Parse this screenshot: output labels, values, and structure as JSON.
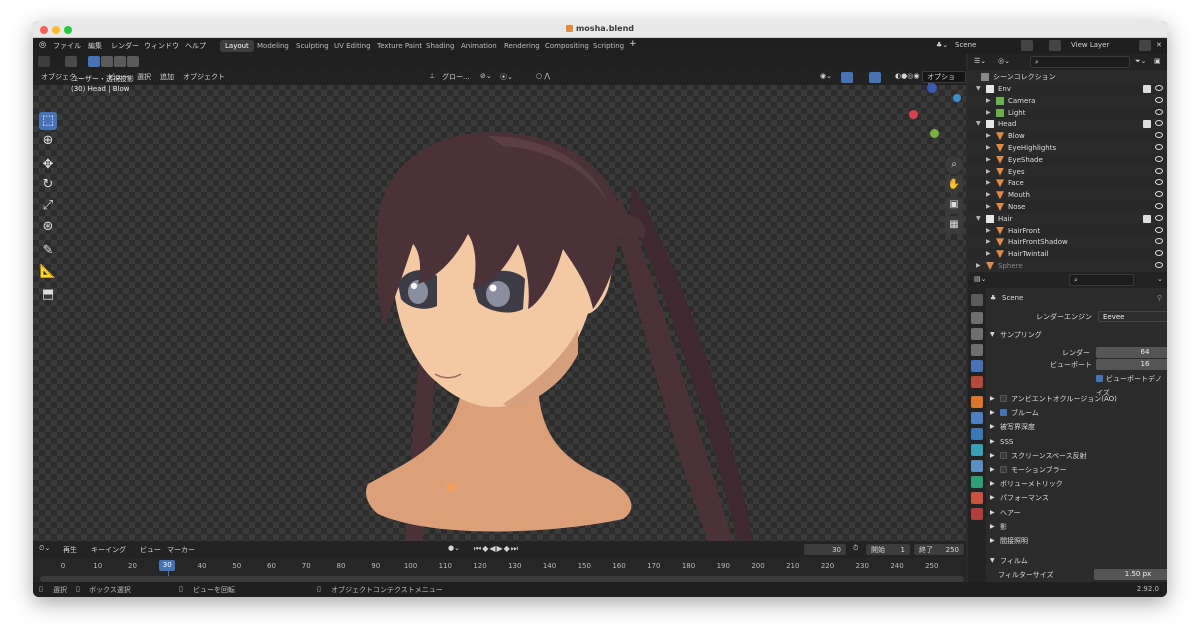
{
  "window": {
    "title": "mosha.blend"
  },
  "topbar": {
    "menus": [
      "ファイル",
      "編集",
      "レンダー",
      "ウィンドウ",
      "ヘルプ"
    ],
    "workspaces": [
      "Layout",
      "Modeling",
      "Sculpting",
      "UV Editing",
      "Texture Paint",
      "Shading",
      "Animation",
      "Rendering",
      "Compositing",
      "Scripting"
    ],
    "active_workspace": "Layout",
    "scene": "Scene",
    "view_layer": "View Layer"
  },
  "viewport": {
    "mode": "オブジェク...",
    "menus": [
      "ビュー",
      "選択",
      "追加",
      "オブジェクト"
    ],
    "transform": "グロー...",
    "options": "オプション",
    "info_line1": "ユーザー・透視投影",
    "info_line2": "(30) Head | Blow"
  },
  "timeline": {
    "menus": [
      "再生",
      "キーイング",
      "ビュー",
      "マーカー"
    ],
    "current_frame": "30",
    "start_label": "開始",
    "start": "1",
    "end_label": "終了",
    "end": "250",
    "ticks": [
      "0",
      "10",
      "20",
      "30",
      "40",
      "50",
      "60",
      "70",
      "80",
      "90",
      "100",
      "110",
      "120",
      "130",
      "140",
      "150",
      "160",
      "170",
      "180",
      "190",
      "200",
      "210",
      "220",
      "230",
      "240",
      "250"
    ]
  },
  "status": {
    "select": "選択",
    "box_select": "ボックス選択",
    "rotate_view": "ビューを回転",
    "context_menu": "オブジェクトコンテクストメニュー",
    "version": "2.92.0"
  },
  "outliner": {
    "root": "シーンコレクション",
    "rows": [
      {
        "name": "Env",
        "kind": "collection",
        "level": 1
      },
      {
        "name": "Camera",
        "kind": "camera",
        "level": 2
      },
      {
        "name": "Light",
        "kind": "light",
        "level": 2
      },
      {
        "name": "Head",
        "kind": "collection",
        "level": 1
      },
      {
        "name": "Blow",
        "kind": "mesh",
        "level": 2
      },
      {
        "name": "EyeHighlights",
        "kind": "mesh",
        "level": 2
      },
      {
        "name": "EyeShade",
        "kind": "mesh",
        "level": 2
      },
      {
        "name": "Eyes",
        "kind": "mesh",
        "level": 2
      },
      {
        "name": "Face",
        "kind": "mesh",
        "level": 2
      },
      {
        "name": "Mouth",
        "kind": "mesh",
        "level": 2
      },
      {
        "name": "Nose",
        "kind": "mesh",
        "level": 2
      },
      {
        "name": "Hair",
        "kind": "collection",
        "level": 1
      },
      {
        "name": "HairFront",
        "kind": "mesh",
        "level": 2
      },
      {
        "name": "HairFrontShadow",
        "kind": "mesh",
        "level": 2
      },
      {
        "name": "HairTwintail",
        "kind": "mesh",
        "level": 2
      },
      {
        "name": "Sphere",
        "kind": "mesh",
        "level": 1
      }
    ]
  },
  "properties": {
    "scene": "Scene",
    "render_engine_label": "レンダーエンジン",
    "render_engine": "Eevee",
    "sampling": "サンプリング",
    "render_label": "レンダー",
    "render_value": "64",
    "viewport_label": "ビューポート",
    "viewport_value": "16",
    "denoise": "ビューポートデノイズ",
    "panels": [
      {
        "label": "アンビエントオクルージョン(AO)",
        "check": "off"
      },
      {
        "label": "ブルーム",
        "check": "on"
      },
      {
        "label": "被写界深度",
        "check": "none"
      },
      {
        "label": "SSS",
        "check": "none"
      },
      {
        "label": "スクリーンスペース反射",
        "check": "off"
      },
      {
        "label": "モーションブラー",
        "check": "off"
      },
      {
        "label": "ボリューメトリック",
        "check": "none"
      },
      {
        "label": "パフォーマンス",
        "check": "none"
      },
      {
        "label": "ヘアー",
        "check": "none"
      },
      {
        "label": "影",
        "check": "none"
      },
      {
        "label": "間接照明",
        "check": "none"
      }
    ],
    "film": "フィルム",
    "filter_size_label": "フィルターサイズ",
    "filter_size": "1.50 px"
  },
  "colors": {
    "accent": "#4772b3",
    "hair": "#4a3238",
    "skin": "#f3c9a4",
    "mesh_icon": "#e08a4a"
  }
}
